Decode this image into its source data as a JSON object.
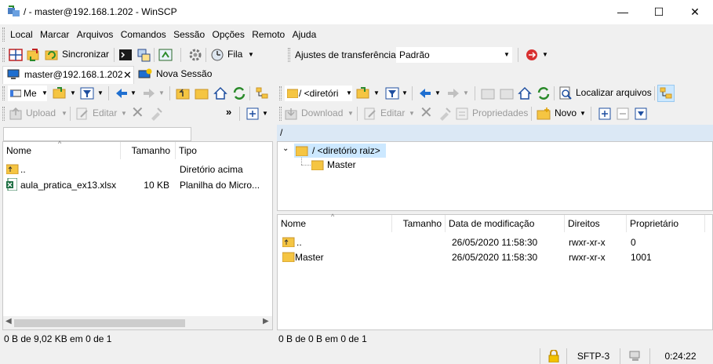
{
  "window": {
    "title": "/ - master@192.168.1.202 - WinSCP",
    "minimize": "—",
    "maximize": "☐",
    "close": "✕"
  },
  "menu": [
    "Local",
    "Marcar",
    "Arquivos",
    "Comandos",
    "Sessão",
    "Opções",
    "Remoto",
    "Ajuda"
  ],
  "main_toolbar": {
    "synchronize": "Sincronizar",
    "queue": "Fila",
    "transfer_settings_label": "Ajustes de transferência",
    "transfer_settings_value": "Padrão"
  },
  "tabs": {
    "session": "master@192.168.1.202",
    "new_session": "Nova Sessão"
  },
  "local": {
    "drive": "Me",
    "upload": "Upload",
    "edit": "Editar",
    "path": "",
    "columns": [
      "Nome",
      "Tamanho",
      "Tipo"
    ],
    "rows": [
      {
        "name": "..",
        "size": "",
        "type": "Diretório acima",
        "icon": "parent-folder-icon"
      },
      {
        "name": "aula_pratica_ex13.xlsx",
        "size": "10 KB",
        "type": "Planilha do Micro...",
        "icon": "excel-file-icon"
      }
    ],
    "status": "0 B de 9,02 KB em 0 de 1"
  },
  "remote": {
    "dir_combo": "/ <diretóri",
    "find_files": "Localizar arquivos",
    "download": "Download",
    "edit": "Editar",
    "properties": "Propriedades",
    "new": "Novo",
    "path": "/",
    "tree": {
      "root": "/ <diretório raiz>",
      "child": "Master"
    },
    "columns": [
      "Nome",
      "Tamanho",
      "Data de modificação",
      "Direitos",
      "Proprietário"
    ],
    "rows": [
      {
        "name": "..",
        "size": "",
        "modified": "26/05/2020 11:58:30",
        "rights": "rwxr-xr-x",
        "owner": "0",
        "icon": "parent-folder-icon"
      },
      {
        "name": "Master",
        "size": "",
        "modified": "26/05/2020 11:58:30",
        "rights": "rwxr-xr-x",
        "owner": "1001",
        "icon": "folder-icon"
      }
    ],
    "status": "0 B de 0 B em 0 de 1"
  },
  "statusbar": {
    "protocol": "SFTP-3",
    "elapsed": "0:24:22"
  },
  "colors": {
    "folder": "#f5c542",
    "accent_blue": "#1f6fd0",
    "green": "#3aa03a",
    "selection": "#cce8ff"
  }
}
